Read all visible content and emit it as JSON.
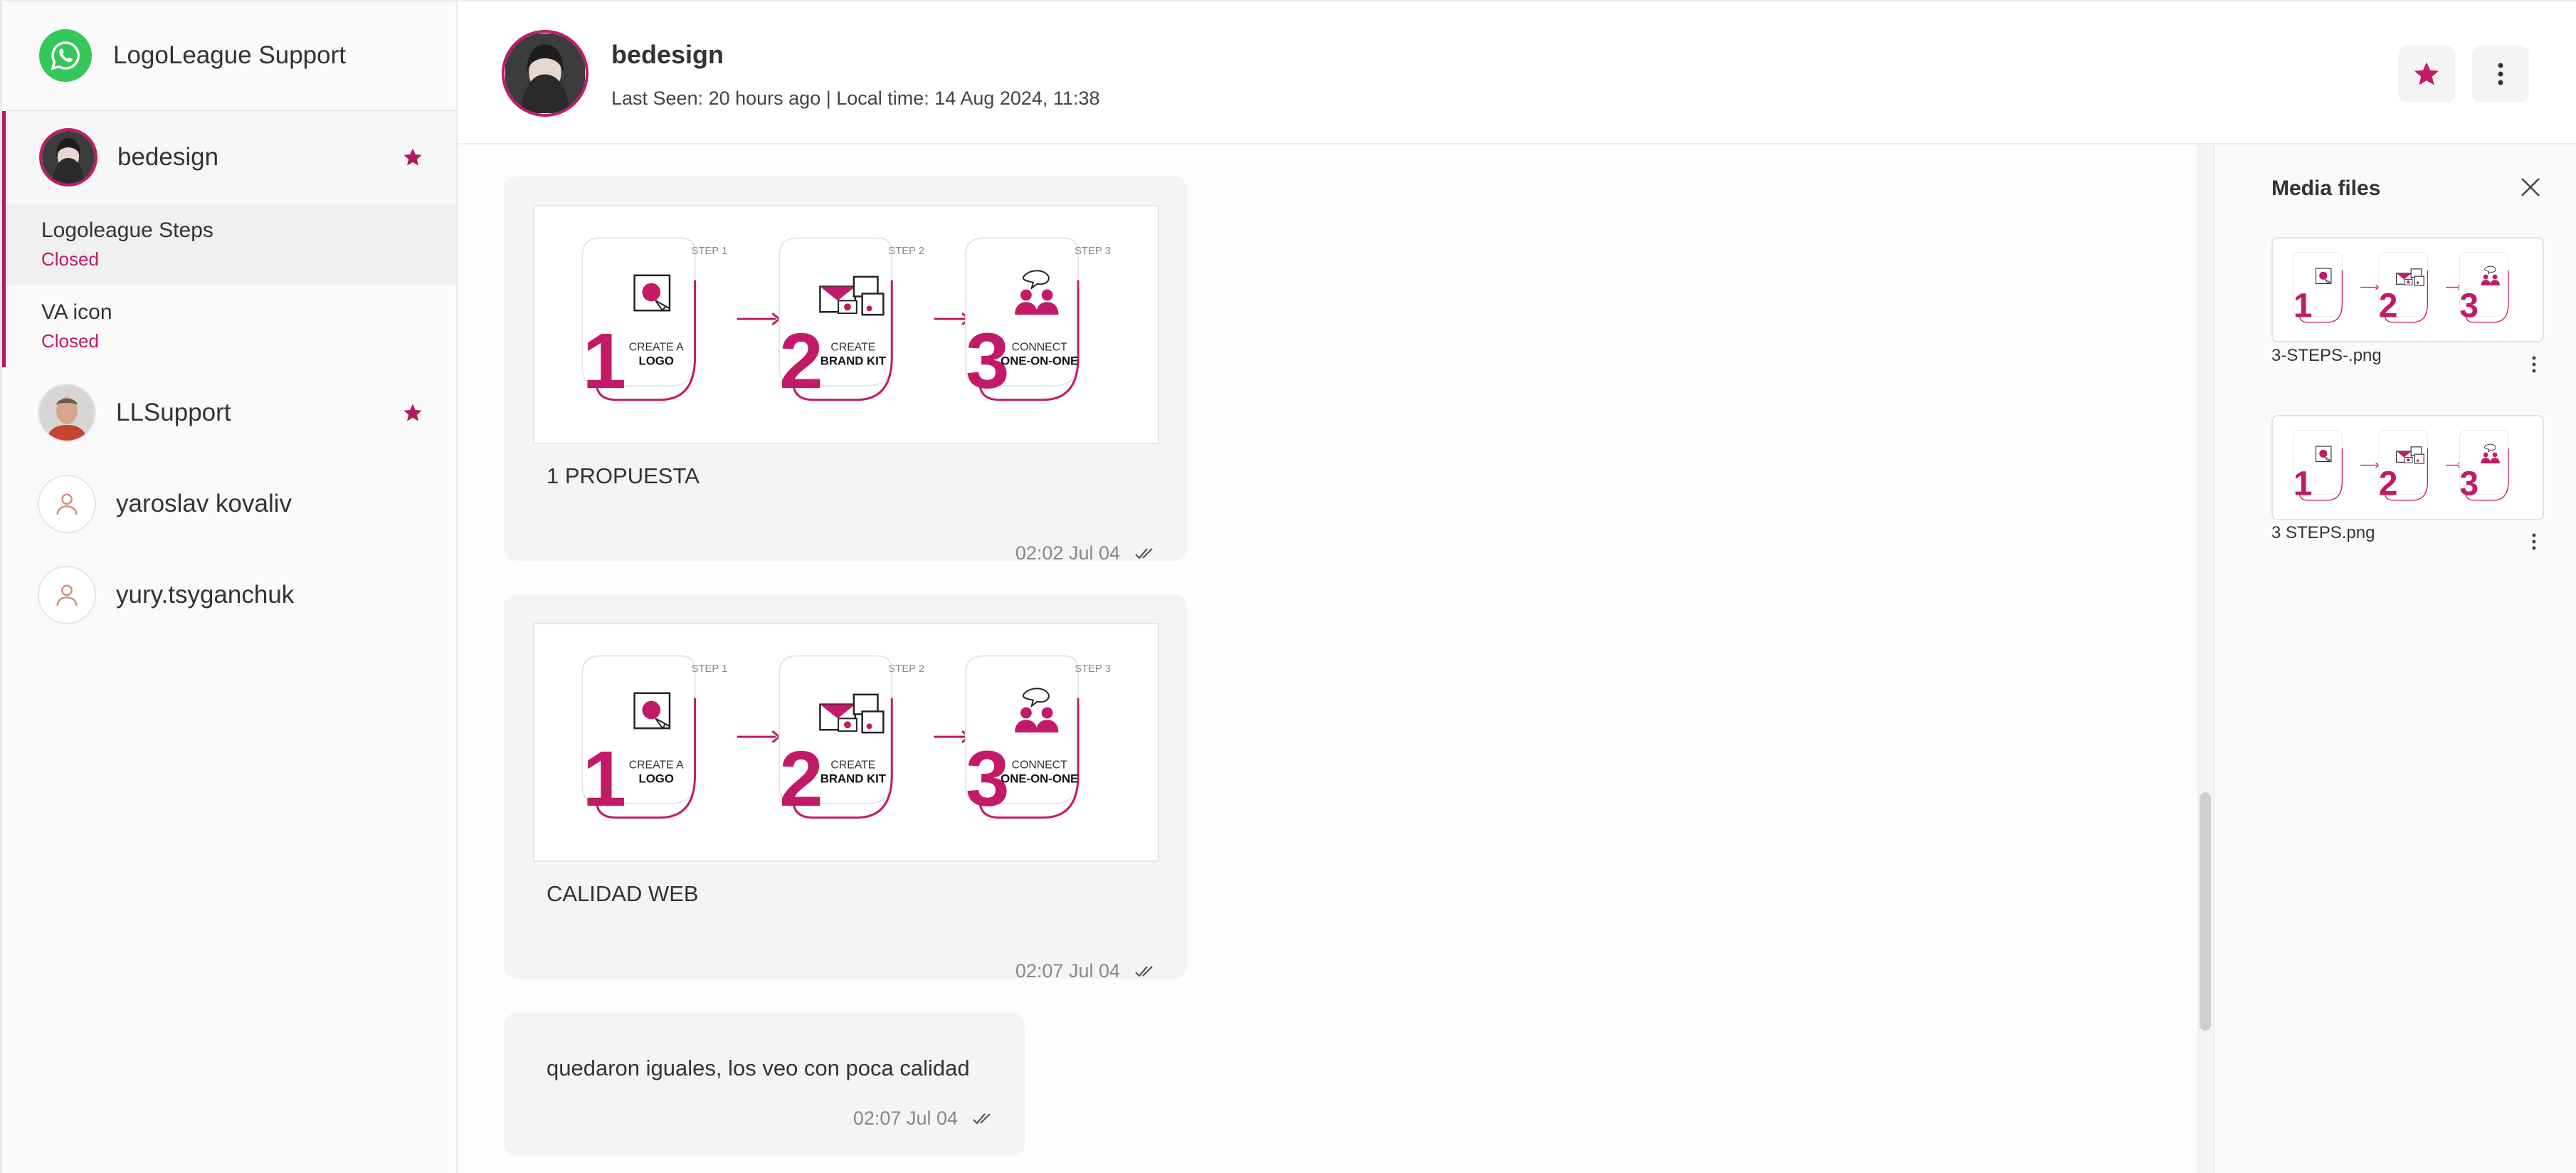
{
  "sidebar": {
    "brand": "LogoLeague Support",
    "contacts": [
      {
        "name": "bedesign",
        "starred": true
      },
      {
        "name": "LLSupport",
        "starred": true
      },
      {
        "name": "yaroslav kovaliv",
        "starred": false
      },
      {
        "name": "yury.tsyganchuk",
        "starred": false
      }
    ],
    "threads": [
      {
        "title": "Logoleague Steps",
        "status": "Closed"
      },
      {
        "title": "VA icon",
        "status": "Closed"
      }
    ]
  },
  "header": {
    "name": "bedesign",
    "subtitle": "Last Seen: 20 hours ago | Local time: 14 Aug 2024, 11:38"
  },
  "steps_graphic": {
    "labels": [
      "STEP 1",
      "STEP 2",
      "STEP 3"
    ],
    "numbers": [
      "1",
      "2",
      "3"
    ],
    "line1": [
      "CREATE A",
      "CREATE",
      "CONNECT"
    ],
    "line2": [
      "LOGO",
      "BRAND KIT",
      "ONE-ON-ONE"
    ]
  },
  "messages": [
    {
      "caption": "1 PROPUESTA",
      "time": "02:02 Jul 04"
    },
    {
      "caption": "CALIDAD WEB",
      "time": "02:07 Jul 04"
    },
    {
      "text": "quedaron iguales, los veo con poca calidad",
      "time": "02:07 Jul 04"
    }
  ],
  "media": {
    "title": "Media files",
    "files": [
      {
        "name": "3-STEPS-.png"
      },
      {
        "name": "3 STEPS.png"
      }
    ]
  },
  "colors": {
    "accent": "#c21a68",
    "whatsapp": "#34c759"
  }
}
